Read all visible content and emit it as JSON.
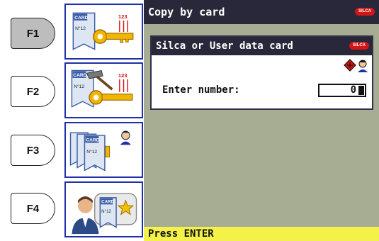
{
  "fkeys": [
    {
      "label": "F1",
      "active": true
    },
    {
      "label": "F2",
      "active": false
    },
    {
      "label": "F3",
      "active": false
    },
    {
      "label": "F4",
      "active": false
    }
  ],
  "tiles": {
    "card_text": "CARD",
    "card_number": "N°12",
    "code": "123"
  },
  "screen": {
    "title": "Copy by card",
    "brand": "SILCA",
    "dialog_title": "Silca or User data card",
    "enter_label": "Enter number:",
    "number_value": "0",
    "status": "Press ENTER"
  },
  "colors": {
    "screen_bg": "#a7ad93",
    "titlebar_bg": "#28283a",
    "status_bg": "#f4f24a",
    "tile_border": "#1f2fa8",
    "brand_red": "#d21616"
  }
}
